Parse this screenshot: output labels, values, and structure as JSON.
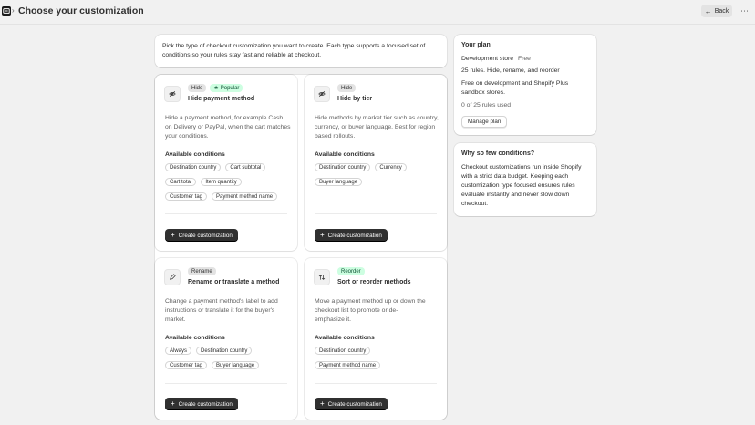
{
  "header": {
    "title": "Choose your customization",
    "back_label": "Back",
    "more_label": "⋯"
  },
  "intro": {
    "text": "Pick the type of checkout customization you want to create. Each type supports a focused set of conditions so your rules stay fast and reliable at checkout."
  },
  "types": [
    {
      "badge": "Hide",
      "extra_badge": "Popular",
      "title": "Hide payment method",
      "icon": "eye-slash-icon",
      "description": "Hide a payment method, for example Cash on Delivery or PayPal, when the cart matches your conditions.",
      "conditions_label": "Available conditions",
      "conditions": [
        "Destination country",
        "Cart subtotal",
        "Cart total",
        "Item quantity",
        "Customer tag",
        "Payment method name"
      ],
      "button": "Create customization"
    },
    {
      "badge": "Hide",
      "title": "Hide by tier",
      "icon": "eye-slash-icon",
      "description": "Hide methods by market tier such as country, currency, or buyer language. Best for region based rollouts.",
      "conditions_label": "Available conditions",
      "conditions": [
        "Destination country",
        "Currency",
        "Buyer language"
      ],
      "button": "Create customization"
    },
    {
      "badge": "Rename",
      "title": "Rename or translate a method",
      "icon": "pencil-icon",
      "description": "Change a payment method's label to add instructions or translate it for the buyer's market.",
      "conditions_label": "Available conditions",
      "conditions": [
        "Always",
        "Destination country",
        "Customer tag",
        "Buyer language"
      ],
      "button": "Create customization"
    },
    {
      "badge": "Reorder",
      "title": "Sort or reorder methods",
      "icon": "sort-arrows-icon",
      "description": "Move a payment method up or down the checkout list to promote or de-emphasize it.",
      "conditions_label": "Available conditions",
      "conditions": [
        "Destination country",
        "Payment method name"
      ],
      "button": "Create customization"
    }
  ],
  "plan": {
    "heading": "Your plan",
    "store": "Development store",
    "plan_name": "Free",
    "rules": "25 rules. Hide, rename, and reorder",
    "note": "Free on development and Shopify Plus sandbox stores.",
    "usage": "0 of 25 rules used",
    "button": "Manage plan"
  },
  "why": {
    "heading": "Why so few conditions?",
    "text": "Checkout customizations run inside Shopify with a strict data budget. Keeping each customization type focused ensures rules evaluate instantly and never slow down checkout."
  }
}
